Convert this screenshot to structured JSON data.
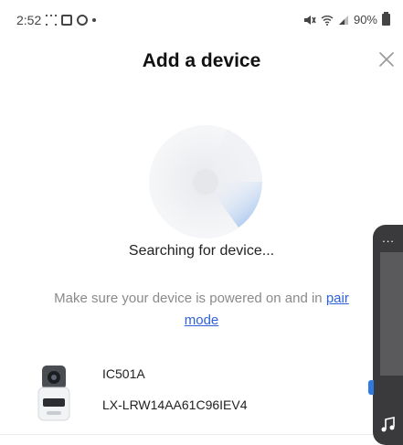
{
  "status_bar": {
    "time": "2:52",
    "battery": "90%"
  },
  "header": {
    "title": "Add a device"
  },
  "search": {
    "status_text": "Searching for device...",
    "hint_prefix": "Make sure your device is powered on and in ",
    "hint_link_part1": "pair",
    "hint_link_part2": "mode"
  },
  "device": {
    "name": "IC501A",
    "serial": "LX-LRW14AA61C96IEV4"
  },
  "side_widget": {
    "more_label": "..."
  },
  "colors": {
    "link": "#2e62d9",
    "radar_sweep": "#9cc0ef",
    "widget_bg": "#3a3a3c"
  }
}
